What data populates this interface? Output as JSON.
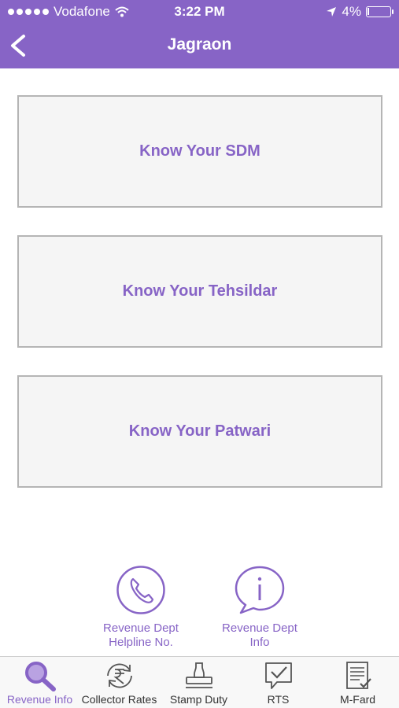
{
  "status_bar": {
    "carrier": "Vodafone",
    "time": "3:22 PM",
    "battery": "4%",
    "battery_level": 0.04
  },
  "navbar": {
    "title": "Jagraon"
  },
  "menu_cards": [
    {
      "label": "Know Your SDM"
    },
    {
      "label": "Know Your Tehsildar"
    },
    {
      "label": "Know Your Patwari"
    }
  ],
  "quick_links": [
    {
      "label_line1": "Revenue Dept",
      "label_line2": "Helpline No.",
      "icon": "phone-icon"
    },
    {
      "label_line1": "Revenue Dept",
      "label_line2": "Info",
      "icon": "info-bubble-icon"
    }
  ],
  "tabs": [
    {
      "label": "Revenue Info",
      "icon": "search-icon",
      "active": true
    },
    {
      "label": "Collector Rates",
      "icon": "rupee-refresh-icon",
      "active": false
    },
    {
      "label": "Stamp Duty",
      "icon": "stamp-icon",
      "active": false
    },
    {
      "label": "RTS",
      "icon": "checkmark-bubble-icon",
      "active": false
    },
    {
      "label": "M-Fard",
      "icon": "document-check-icon",
      "active": false
    }
  ],
  "colors": {
    "accent": "#8764c6",
    "card_bg": "#f5f5f5",
    "card_border": "#b5b5b5"
  }
}
